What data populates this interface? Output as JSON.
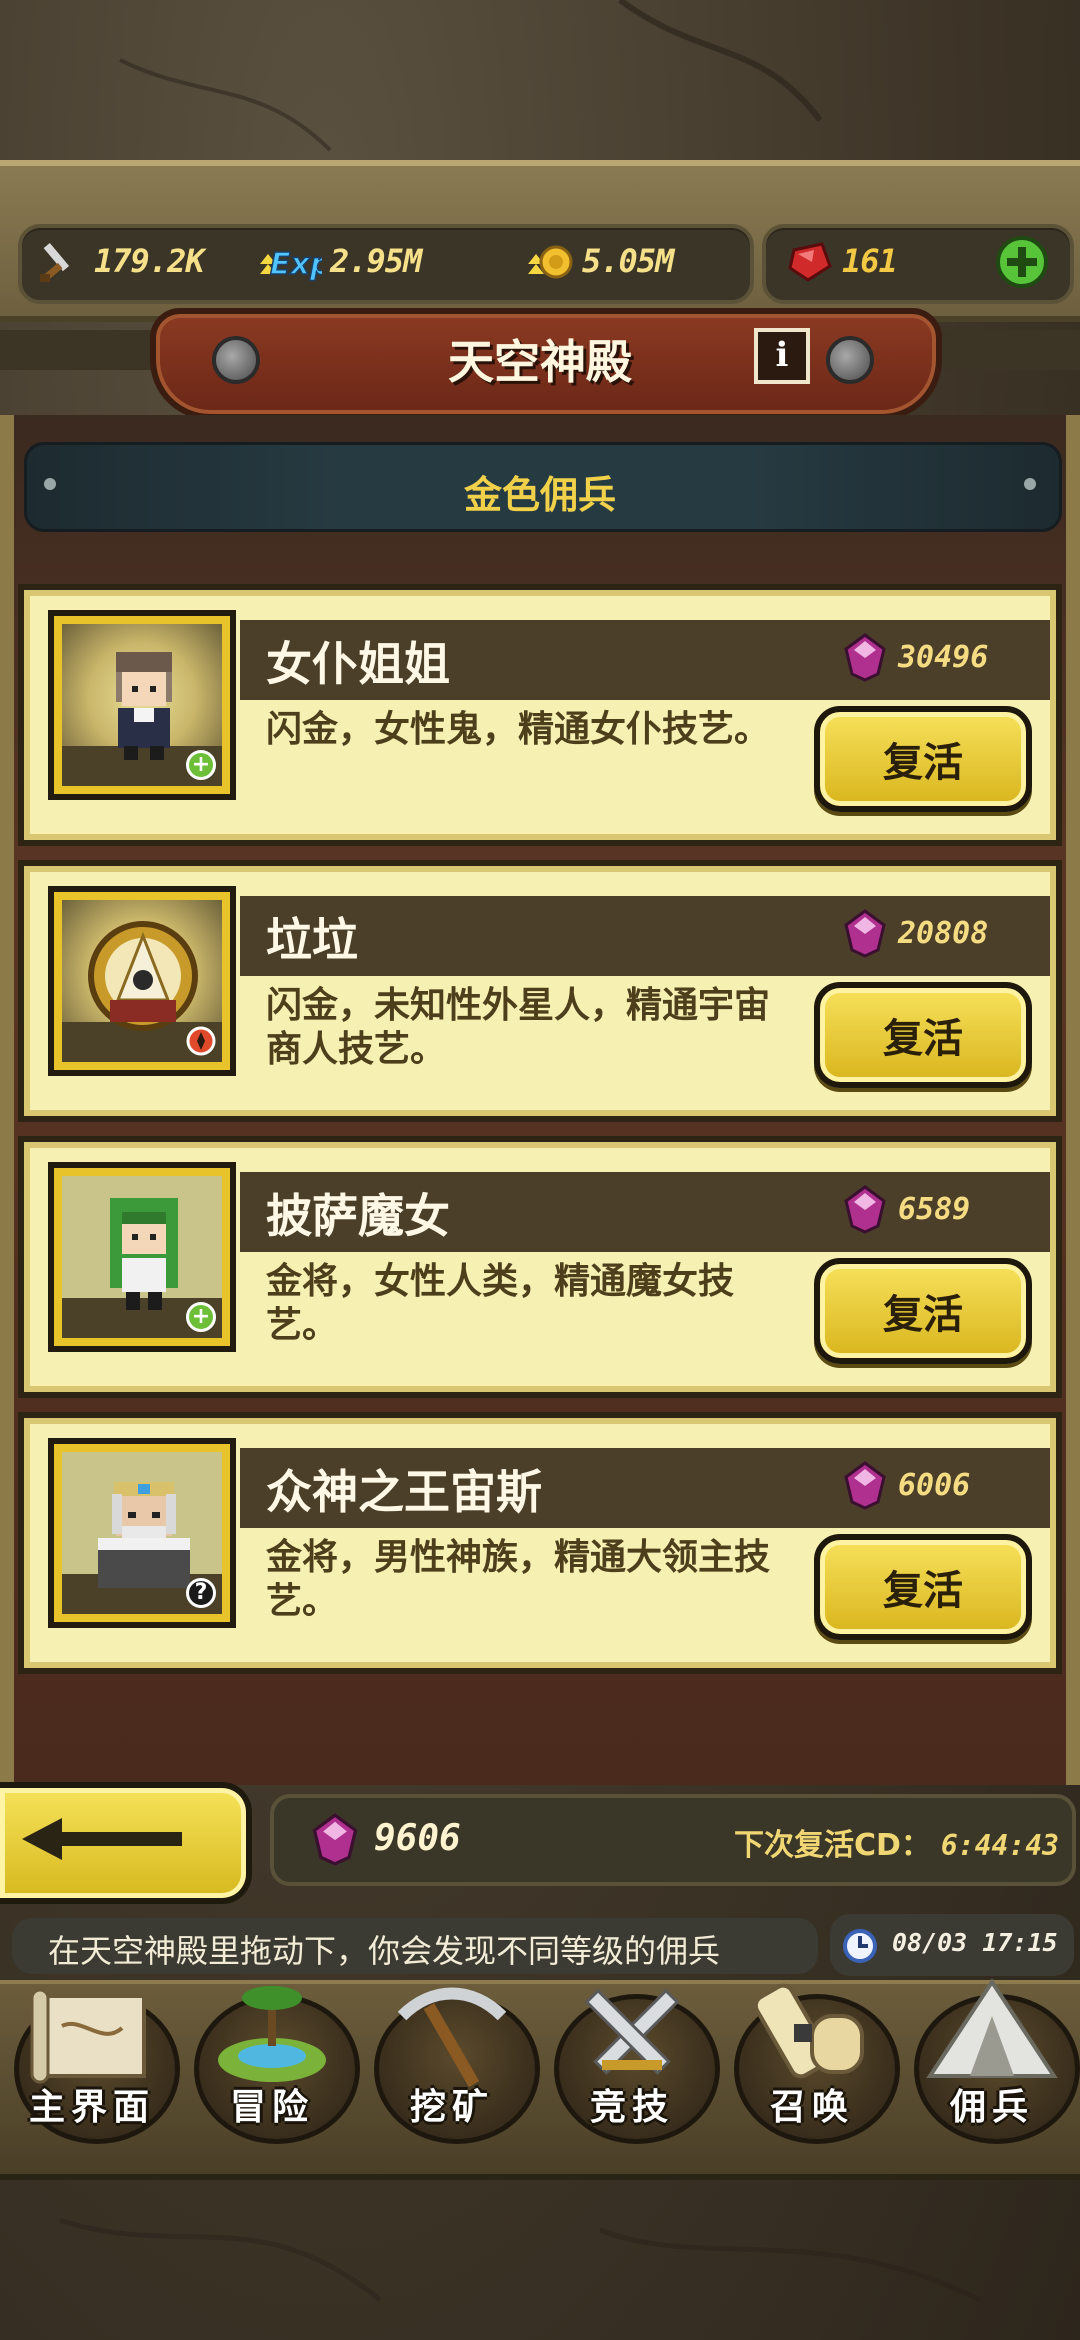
{
  "resources": {
    "attack": "179.2K",
    "exp_label": "Exp",
    "exp": "2.95M",
    "gold": "5.05M",
    "rubies": "161"
  },
  "header": {
    "title": "天空神殿",
    "info_label": "i"
  },
  "subtab": {
    "label": "金色佣兵"
  },
  "mercenaries": [
    {
      "name": "女仆姐姐",
      "cost": "30496",
      "desc": "闪金，女性鬼，精通女仆技艺。",
      "badge": "+",
      "revive_label": "复活"
    },
    {
      "name": "垃垃",
      "cost": "20808",
      "desc": "闪金，未知性外星人，精通宇宙商人技艺。",
      "badge": "",
      "revive_label": "复活"
    },
    {
      "name": "披萨魔女",
      "cost": "6589",
      "desc": "金将，女性人类，精通魔女技艺。",
      "badge": "+",
      "revive_label": "复活"
    },
    {
      "name": "众神之王宙斯",
      "cost": "6006",
      "desc": "金将，男性神族，精通大领主技艺。",
      "badge": "?",
      "revive_label": "复活"
    }
  ],
  "footer": {
    "gems": "9606",
    "cooldown_label": "下次复活CD：",
    "cooldown_time": "6:44:43",
    "tip": "在天空神殿里拖动下，你会发现不同等级的佣兵",
    "clock": "08/03 17:15"
  },
  "nav": [
    {
      "label": "主界面",
      "icon": "scroll-map-icon"
    },
    {
      "label": "冒险",
      "icon": "island-icon"
    },
    {
      "label": "挖矿",
      "icon": "pickaxe-icon"
    },
    {
      "label": "竞技",
      "icon": "crossed-swords-icon"
    },
    {
      "label": "召唤",
      "icon": "summon-scroll-icon"
    },
    {
      "label": "佣兵",
      "icon": "tent-icon"
    }
  ],
  "colors": {
    "gold_text": "#f1d14a",
    "card_bg": "#f7f0b3",
    "banner_red": "#8b3a22",
    "button_yellow": "#f7e15b"
  }
}
